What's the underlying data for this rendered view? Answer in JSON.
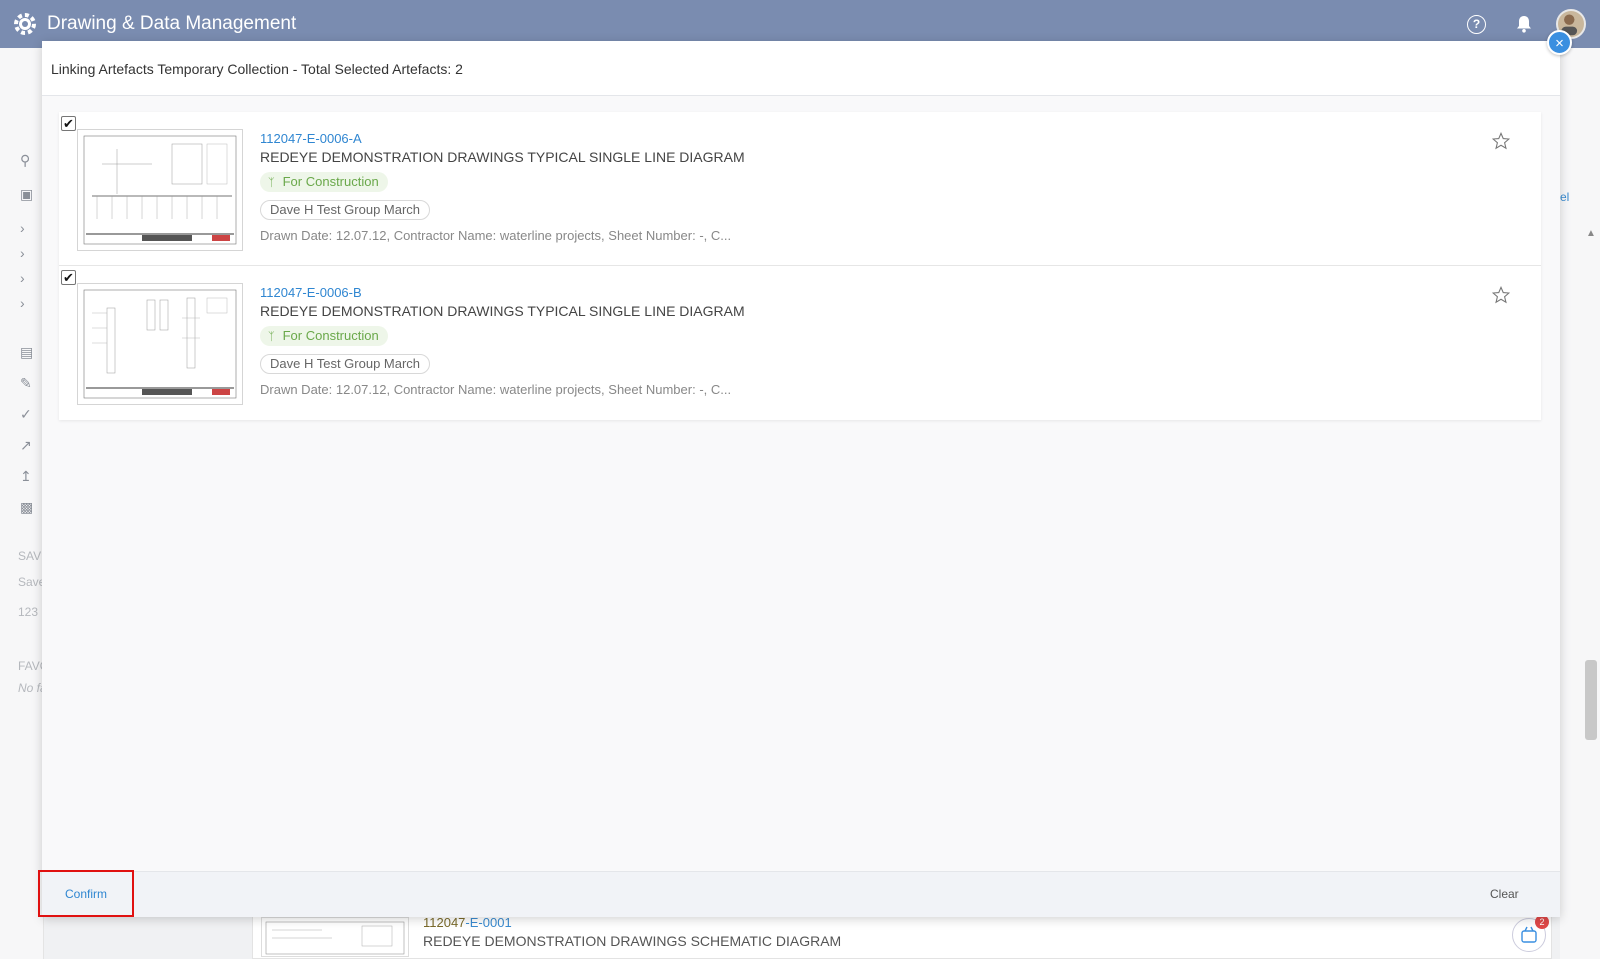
{
  "app": {
    "title": "Drawing & Data Management",
    "help_glyph": "?"
  },
  "background": {
    "sidebar_texts": [
      "SAVE",
      "Save",
      "123",
      "FAVO",
      "No fa"
    ],
    "bottom_row": {
      "code_prefix": "112047",
      "code_suffix": "-E-0001",
      "title": "REDEYE DEMONSTRATION DRAWINGS SCHEMATIC DIAGRAM"
    },
    "cart_count": "2",
    "right_cut_text": "el"
  },
  "modal": {
    "title": "Linking Artefacts Temporary Collection - Total Selected Artefacts: 2",
    "close_glyph": "×",
    "items": [
      {
        "checked": "✔",
        "code": "112047-E-0006-A",
        "name": "REDEYE DEMONSTRATION DRAWINGS TYPICAL SINGLE LINE DIAGRAM",
        "status": "For Construction",
        "group": "Dave H Test Group March",
        "meta": "Drawn Date: 12.07.12, Contractor Name: waterline projects, Sheet Number: -, C..."
      },
      {
        "checked": "✔",
        "code": "112047-E-0006-B",
        "name": "REDEYE DEMONSTRATION DRAWINGS TYPICAL SINGLE LINE DIAGRAM",
        "status": "For Construction",
        "group": "Dave H Test Group March",
        "meta": "Drawn Date: 12.07.12, Contractor Name: waterline projects, Sheet Number: -, C..."
      }
    ],
    "footer": {
      "confirm_label": "Confirm",
      "clear_label": "Clear"
    }
  },
  "colors": {
    "header": "#7a8cb0",
    "link": "#2f86d1",
    "status_green": "#6aa84a",
    "highlight_red": "#e01010"
  }
}
